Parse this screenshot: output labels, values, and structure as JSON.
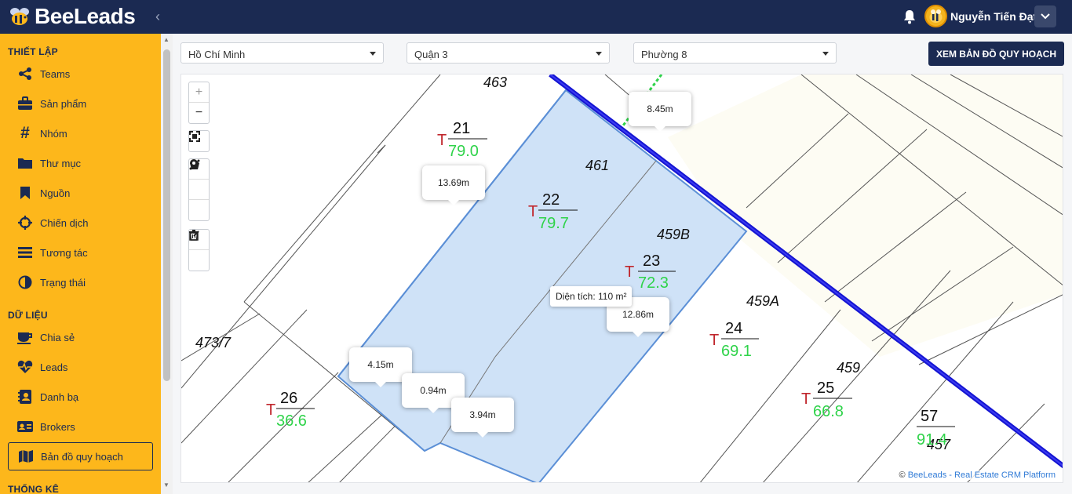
{
  "app": {
    "brand_part1": "Bee",
    "brand_part2": "Leads",
    "collapse_icon": "chevron-left-icon"
  },
  "header": {
    "user_name": "Nguyễn Tiến Đạt",
    "notification_icon": "bell-icon",
    "menu_icon": "chevron-down-icon"
  },
  "colors": {
    "primary": "#1b2a52",
    "accent": "#fdb71b",
    "parcel_fill": "#cfe2f7",
    "road": "#1414d2"
  },
  "sidebar": {
    "sections": [
      {
        "title": "THIẾT LẬP"
      },
      {
        "title": "DỮ LIỆU"
      },
      {
        "title": "THỐNG KÊ"
      }
    ],
    "items": [
      {
        "label": "Teams",
        "icon": "share-icon"
      },
      {
        "label": "Sản phẩm",
        "icon": "briefcase-icon"
      },
      {
        "label": "Nhóm",
        "icon": "hashtag-icon"
      },
      {
        "label": "Thư mục",
        "icon": "folder-icon"
      },
      {
        "label": "Nguồn",
        "icon": "bookmark-icon"
      },
      {
        "label": "Chiến dịch",
        "icon": "crosshair-icon"
      },
      {
        "label": "Tương tác",
        "icon": "list-icon"
      },
      {
        "label": "Trạng thái",
        "icon": "half-circle-icon"
      },
      {
        "label": "Chia sẻ",
        "icon": "coffee-icon"
      },
      {
        "label": "Leads",
        "icon": "heartbeat-icon"
      },
      {
        "label": "Danh bạ",
        "icon": "contact-book-icon"
      },
      {
        "label": "Brokers",
        "icon": "id-card-icon"
      },
      {
        "label": "Bản đồ quy hoạch",
        "icon": "map-icon",
        "active": true
      }
    ]
  },
  "filters": {
    "province": "Hồ Chí Minh",
    "district": "Quận 3",
    "ward": "Phường 8"
  },
  "actions": {
    "view_plan_map": "XEM BẢN ĐỒ QUY HOẠCH"
  },
  "map": {
    "controls": {
      "zoom_in": "+",
      "zoom_out": "−",
      "fullscreen_icon": "fullscreen-icon",
      "draw_line_icon": "draw-line-icon",
      "draw_polygon_icon": "draw-polygon-icon",
      "marker_icon": "marker-icon",
      "edit_icon": "edit-icon",
      "delete_icon": "trash-icon"
    },
    "measurements": [
      "8.45m",
      "13.69m",
      "12.86m",
      "4.15m",
      "0.94m",
      "3.94m"
    ],
    "area_label": "Diện tích: 110 m²",
    "house_numbers": [
      "463",
      "461",
      "459B",
      "459A",
      "459",
      "473/7",
      "457"
    ],
    "parcels": [
      {
        "prefix": "T",
        "number": "21",
        "area": "79.0"
      },
      {
        "prefix": "T",
        "number": "22",
        "area": "79.7"
      },
      {
        "prefix": "T",
        "number": "23",
        "area": "72.3"
      },
      {
        "prefix": "T",
        "number": "24",
        "area": "69.1"
      },
      {
        "prefix": "T",
        "number": "25",
        "area": "66.8"
      },
      {
        "prefix": "T",
        "number": "26",
        "area": "36.6"
      },
      {
        "prefix": "",
        "number": "57",
        "area": "91.4"
      }
    ],
    "attribution_brand": "BeeLeads",
    "attribution_rest": " - Real Estate CRM Platform",
    "attribution_prefix": "© "
  }
}
